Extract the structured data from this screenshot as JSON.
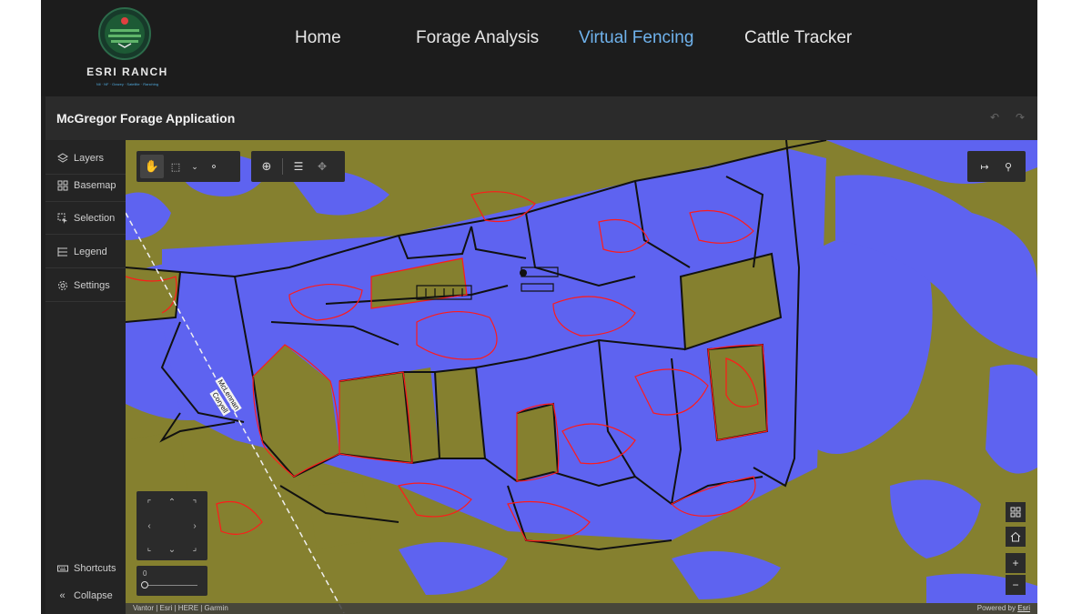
{
  "brand": {
    "name": "ESRI RANCH",
    "tagline": "Nil · NF · Grazey · Satellite · Ranching"
  },
  "nav": {
    "items": [
      {
        "label": "Home",
        "active": false
      },
      {
        "label": "Forage Analysis",
        "active": false
      },
      {
        "label": "Virtual Fencing",
        "active": true
      },
      {
        "label": "Cattle Tracker",
        "active": false
      }
    ]
  },
  "app": {
    "title": "McGregor Forage Application"
  },
  "panel": {
    "items": [
      {
        "label": "Layers",
        "icon": "layers-icon"
      },
      {
        "label": "Basemap",
        "icon": "basemap-grid-icon"
      },
      {
        "label": "Selection",
        "icon": "selection-icon"
      },
      {
        "label": "Legend",
        "icon": "legend-list-icon"
      },
      {
        "label": "Settings",
        "icon": "gear-icon"
      }
    ],
    "shortcuts": "Shortcuts",
    "collapse": "Collapse"
  },
  "map": {
    "road_label_1": "McLennan",
    "road_label_2": "Coryell",
    "zoom_level": "0",
    "attribution": "Vantor | Esri | HERE | Garmin",
    "powered_by": "Powered by",
    "powered_by_link": "Esri"
  },
  "colors": {
    "water_blue": "#5e63f0",
    "forage_olive": "#85802f",
    "pasture_outline": "#111111",
    "change_outline_red": "#ff1a1a",
    "active_nav": "#6fb2ec"
  }
}
